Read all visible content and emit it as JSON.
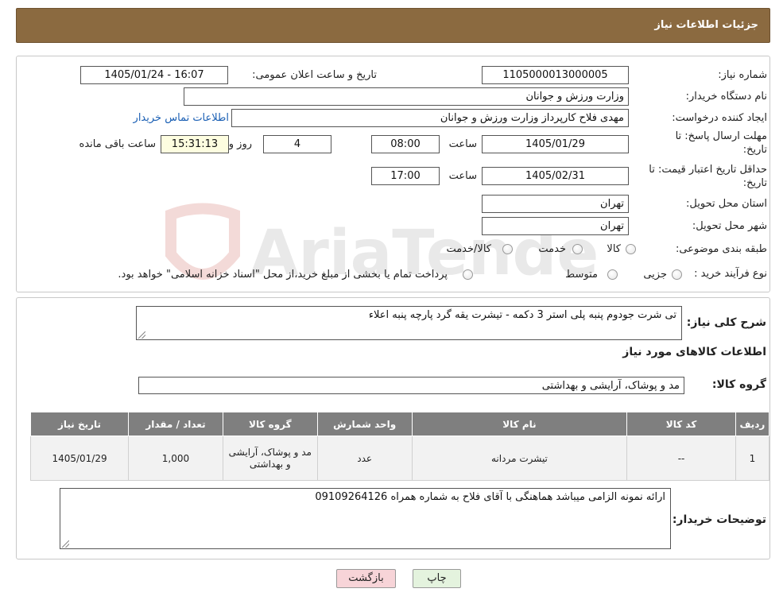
{
  "header": {
    "title": "جزئیات اطلاعات نیاز"
  },
  "watermark": {
    "text": "AriaTender.neT"
  },
  "form": {
    "need_number": {
      "label": "شماره نیاز:",
      "value": "1105000013000005"
    },
    "announce": {
      "label": "تاریخ و ساعت اعلان عمومی:",
      "value": "1405/01/24 - 16:07"
    },
    "buyer_org": {
      "label": "نام دستگاه خریدار:",
      "value": "وزارت ورزش و جوانان"
    },
    "requester": {
      "label": "ایجاد کننده درخواست:",
      "value": "مهدی فلاح کارپرداز وزارت ورزش و جوانان",
      "contact_link": "اطلاعات تماس خریدار"
    },
    "reply_deadline": {
      "label_line1": "مهلت ارسال پاسخ: تا",
      "label_line2": "تاریخ:",
      "date": "1405/01/29",
      "time_label": "ساعت",
      "time": "08:00",
      "days": "4",
      "days_label": "روز و",
      "remaining": "15:31:13",
      "remaining_label": "ساعت باقی مانده"
    },
    "price_validity": {
      "label_line1": "حداقل تاریخ اعتبار قیمت: تا",
      "label_line2": "تاریخ:",
      "date": "1405/02/31",
      "time_label": "ساعت",
      "time": "17:00"
    },
    "province": {
      "label": "استان محل تحویل:",
      "value": "تهران"
    },
    "city": {
      "label": "شهر محل تحویل:",
      "value": "تهران"
    },
    "category": {
      "label": "طبقه بندی موضوعی:",
      "options": [
        "کالا",
        "خدمت",
        "کالا/خدمت"
      ]
    },
    "purchase_type": {
      "label": "نوع فرآیند خرید :",
      "options": [
        "جزیی",
        "متوسط"
      ],
      "note": "پرداخت تمام یا بخشی از مبلغ خرید،از محل \"اسناد خزانه اسلامی\" خواهد بود."
    }
  },
  "summary": {
    "label": "شرح کلی نیاز:",
    "value": "تی شرت جودوم پنبه پلی استر 3 دکمه  - تیشرت  یقه گرد پارچه پنبه اعلاء",
    "items_title": "اطلاعات کالاهای مورد نیاز",
    "group_label": "گروه کالا:",
    "group_value": "مد و پوشاک، آرایشی و بهداشتی"
  },
  "table": {
    "headers": [
      "ردیف",
      "کد کالا",
      "نام کالا",
      "واحد شمارش",
      "گروه کالا",
      "تعداد / مقدار",
      "تاریخ نیاز"
    ],
    "rows": [
      {
        "row": "1",
        "code": "--",
        "name": "تیشرت مردانه",
        "unit": "عدد",
        "group": "مد و پوشاک، آرایشی و بهداشتی",
        "qty": "1,000",
        "date": "1405/01/29"
      }
    ]
  },
  "buyer_notes": {
    "label": "توضیحات خریدار:",
    "value": "ارائه نمونه الزامی میباشد  هماهنگی با آقای فلاح به شماره همراه 09109264126"
  },
  "buttons": {
    "print": "چاپ",
    "back": "بازگشت"
  },
  "colors": {
    "header": "#8b6a40",
    "back_button": "#f7d4d8",
    "print_button": "#e4f3de",
    "remaining_box": "#fdfde0",
    "table_header": "#7f7f7f"
  }
}
